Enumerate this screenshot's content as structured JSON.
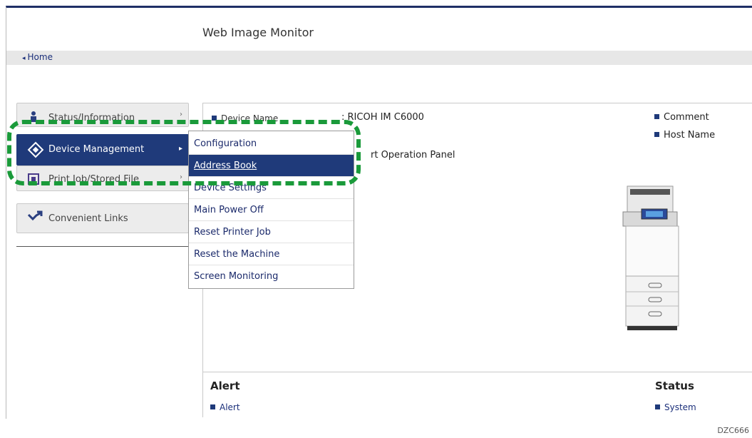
{
  "app": {
    "title": "Web Image Monitor"
  },
  "nav": {
    "home_label": "Home"
  },
  "menu": {
    "status": "Status/Information",
    "device_management": "Device Management",
    "print_job": "Print Job/Stored File",
    "convenient_links": "Convenient Links"
  },
  "submenu": {
    "items": [
      "Configuration",
      "Address Book",
      "Device Settings",
      "Main Power Off",
      "Reset Printer Job",
      "Reset the Machine",
      "Screen Monitoring"
    ],
    "active": "Address Book"
  },
  "device": {
    "name_label": "Device Name",
    "name_value": ": RICOH IM C6000",
    "panel_value": "rt Operation Panel"
  },
  "right_links": {
    "comment": "Comment",
    "host_name": "Host Name"
  },
  "sections": {
    "alert_heading": "Alert",
    "alert_link": "Alert",
    "status_heading": "Status",
    "system_link": "System"
  },
  "figure_id": "DZC666",
  "colors": {
    "accent": "#1f3a7a",
    "highlight": "#1a9a3a"
  }
}
